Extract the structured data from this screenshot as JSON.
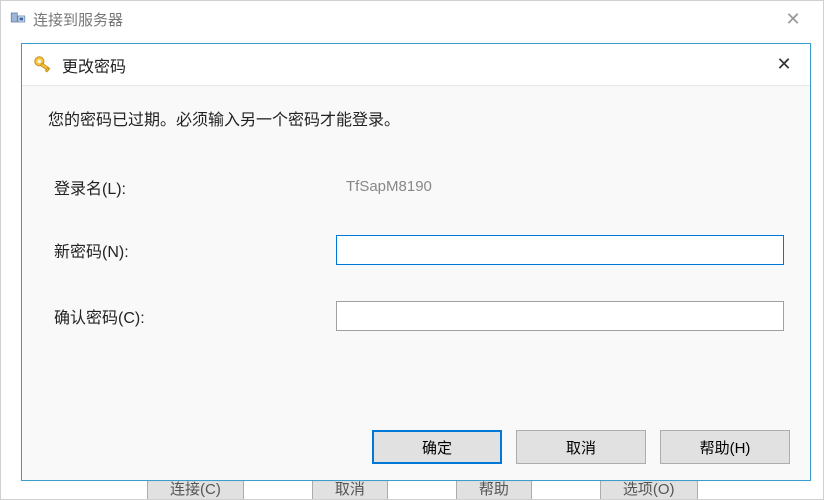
{
  "parent": {
    "title": "连接到服务器",
    "bottom_fragments": [
      "连接(C)",
      "取消",
      "帮助",
      "选项(O)"
    ]
  },
  "dialog": {
    "title": "更改密码",
    "message": "您的密码已过期。必须输入另一个密码才能登录。",
    "login_label": "登录名(L):",
    "login_value": "TfSapM8190",
    "newpw_label": "新密码(N):",
    "confirm_label": "确认密码(C):",
    "ok_label": "确定",
    "cancel_label": "取消",
    "help_label": "帮助(H)"
  }
}
